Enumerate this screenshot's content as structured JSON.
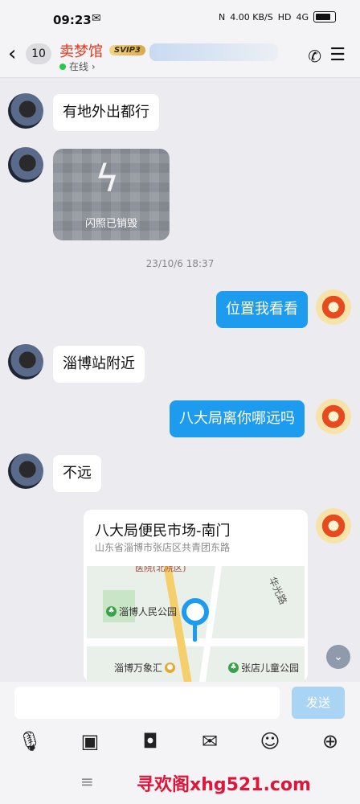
{
  "status": {
    "time": "09:23",
    "wechat_icon": "wechat-icon",
    "network": "4.00 KB/S",
    "hd": "HD",
    "signal": "4G"
  },
  "header": {
    "unread": "10",
    "name": "卖梦馆",
    "badge": "SVIP3",
    "status": "在线 ›"
  },
  "messages": {
    "m1": "有地外出都行",
    "flash_label": "闪照已销毁",
    "timestamp": "23/10/6 18:37",
    "m2": "位置我看看",
    "m3": "淄博站附近",
    "m4": "八大局离你哪远吗",
    "m5": "不远"
  },
  "map": {
    "title": "八大局便民市场-南门",
    "address": "山东省淄博市张店区共青团东路",
    "poi1": "淄博人民公园",
    "poi2": "淄博万象汇",
    "poi3": "张店儿童公园",
    "street": "华光路",
    "top_label": "医院(北院区)"
  },
  "input": {
    "send": "发送"
  },
  "watermark": "寻欢阁xhg521.com",
  "colors": {
    "accent": "#1c9bef",
    "name": "#e8361c"
  }
}
